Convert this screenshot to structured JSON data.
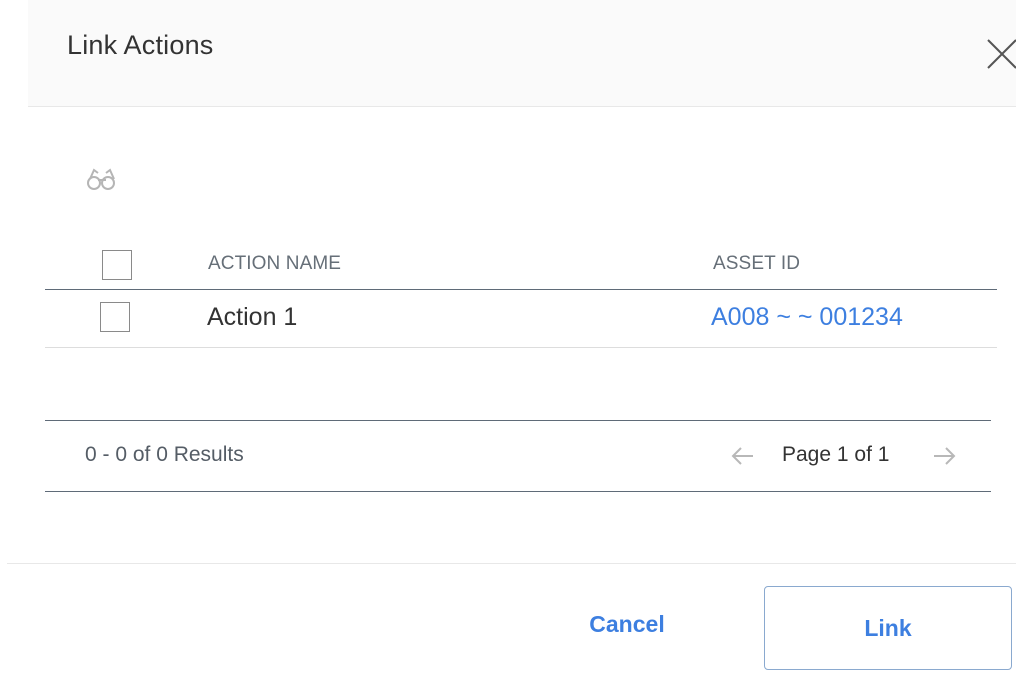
{
  "dialog": {
    "title": "Link Actions",
    "close_icon": "close-icon"
  },
  "toolbar": {
    "search_icon": "binoculars-icon"
  },
  "grid": {
    "columns": [
      "ACTION NAME",
      "ASSET ID"
    ],
    "rows": [
      {
        "action_name": "Action 1",
        "asset_id": "A008 ~ ~ 001234"
      }
    ]
  },
  "pager": {
    "results_text": "0 - 0 of 0 Results",
    "page_text": "Page 1 of 1",
    "prev_icon": "arrow-left-icon",
    "next_icon": "arrow-right-icon"
  },
  "footer": {
    "cancel_label": "Cancel",
    "link_label": "Link"
  },
  "colors": {
    "accent": "#3d7fe0",
    "text": "#333333",
    "muted": "#666f78",
    "divider": "#5f6b78"
  }
}
